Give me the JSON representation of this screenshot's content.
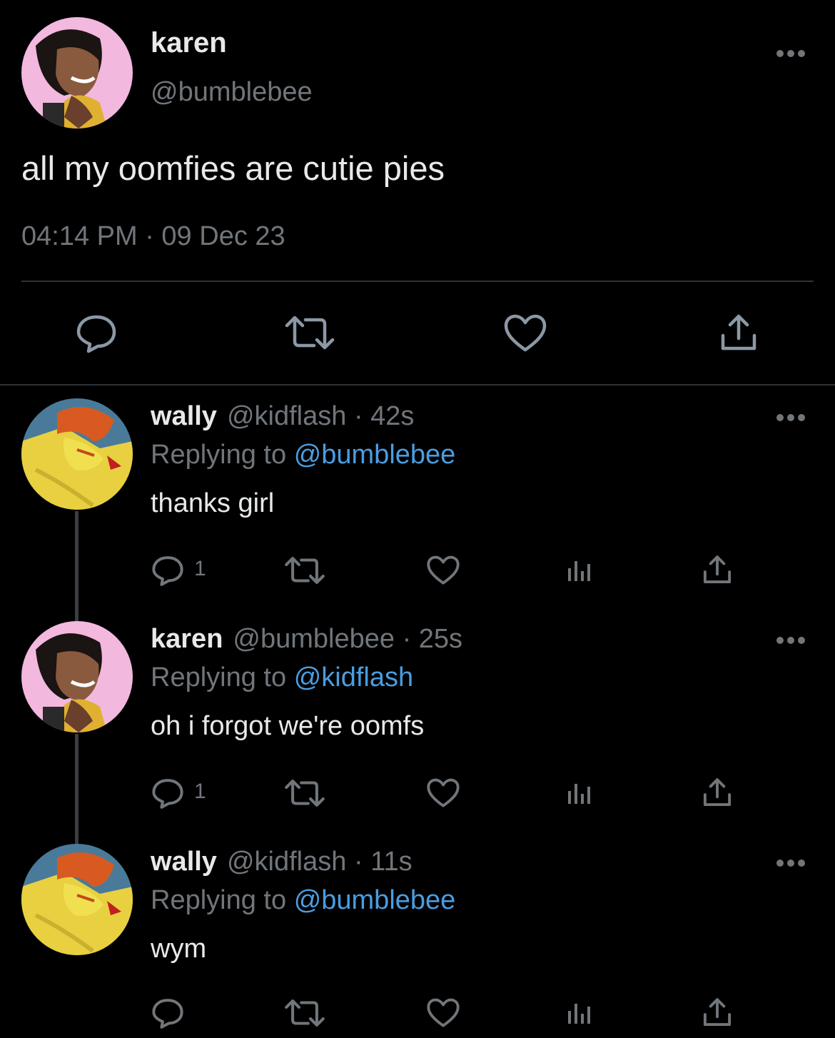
{
  "main_tweet": {
    "name": "karen",
    "handle": "@bumblebee",
    "text": "all my oomfies are cutie pies",
    "timestamp": "04:14 PM · 09 Dec 23",
    "avatar": "karen-avatar",
    "actions": [
      "reply-icon",
      "retweet-icon",
      "like-icon",
      "share-icon"
    ]
  },
  "replies": [
    {
      "name": "wally",
      "handle": "@kidflash",
      "time": "· 42s",
      "replying_prefix": "Replying to",
      "replying_to": "@bumblebee",
      "text": "thanks girl",
      "reply_count": "1",
      "avatar": "wally-avatar"
    },
    {
      "name": "karen",
      "handle": "@bumblebee",
      "time": "· 25s",
      "replying_prefix": "Replying to",
      "replying_to": "@kidflash",
      "text": "oh i forgot we're oomfs",
      "reply_count": "1",
      "avatar": "karen-avatar"
    },
    {
      "name": "wally",
      "handle": "@kidflash",
      "time": "· 11s",
      "replying_prefix": "Replying to",
      "replying_to": "@bumblebee",
      "text": "wym",
      "reply_count": "",
      "avatar": "wally-avatar"
    }
  ],
  "colors": {
    "background": "#000000",
    "text": "#e7e9ea",
    "secondary": "#71767b",
    "link": "#4a9de0",
    "divider": "#2f3336"
  }
}
